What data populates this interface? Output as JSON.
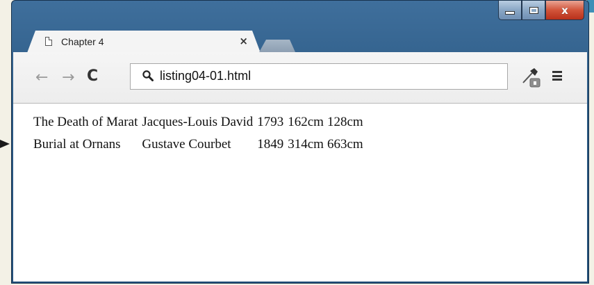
{
  "browser": {
    "tab": {
      "title": "Chapter 4",
      "close_glyph": "×"
    },
    "toolbar": {
      "back_glyph": "←",
      "forward_glyph": "→",
      "reload_glyph": "C",
      "address": "listing04-01.html"
    },
    "window_buttons": {
      "close_glyph": "x"
    },
    "icons": [
      "document-icon",
      "search-icon",
      "eyedropper-icon",
      "menu-icon"
    ],
    "colors": {
      "frame": "#2b5983",
      "close_button": "#d2543a",
      "page": "#ffffff"
    }
  },
  "page": {
    "rows": [
      {
        "title": "The Death of Marat",
        "artist": "Jacques-Louis David",
        "year": "1793",
        "width": "162cm",
        "height": "128cm"
      },
      {
        "title": "Burial at Ornans",
        "artist": "Gustave Courbet",
        "year": "1849",
        "width": "314cm",
        "height": "663cm"
      }
    ]
  }
}
